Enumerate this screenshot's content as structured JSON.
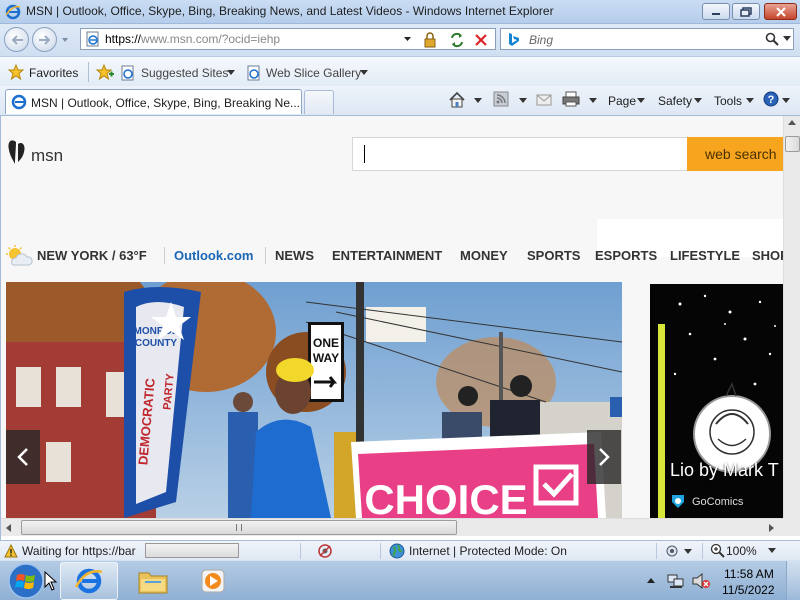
{
  "window": {
    "title": "MSN | Outlook, Office, Skype, Bing, Breaking News, and Latest Videos - Windows Internet Explorer"
  },
  "address_bar": {
    "url_prefix": "https://",
    "url_rest": "www.msn.com/?ocid=iehp"
  },
  "search_bar": {
    "engine": "Bing"
  },
  "favorites_bar": {
    "favorites_label": "Favorites",
    "items": [
      {
        "label": "Suggested Sites"
      },
      {
        "label": "Web Slice Gallery"
      }
    ]
  },
  "tab": {
    "title": "MSN | Outlook, Office, Skype, Bing, Breaking Ne..."
  },
  "command_bar": {
    "page_label": "Page",
    "safety_label": "Safety",
    "tools_label": "Tools"
  },
  "msn": {
    "logo_text": "msn",
    "search_button": "web search",
    "weather": "NEW YORK / 63°F",
    "nav": [
      "Outlook.com",
      "NEWS",
      "ENTERTAINMENT",
      "MONEY",
      "SPORTS",
      "ESPORTS",
      "LIFESTYLE",
      "SHOP"
    ],
    "hero": {
      "sign_one_way": [
        "ONE",
        "WAY"
      ],
      "banner_lines": [
        "MONROE",
        "COUNTY",
        "DEMOCRATIC",
        "PARTY"
      ],
      "poster_text": "CHOICE"
    },
    "comic": {
      "title": "Lio by Mark T",
      "source": "GoComics"
    }
  },
  "status_bar": {
    "text": "Waiting for https://bar",
    "zone": "Internet | Protected Mode: On",
    "zoom": "100%"
  },
  "taskbar": {
    "time": "11:58 AM",
    "date": "11/5/2022"
  },
  "colors": {
    "accent_orange": "#f7a51e",
    "outlook_blue": "#1a66b5",
    "chrome_blue": "#dce7f5"
  }
}
